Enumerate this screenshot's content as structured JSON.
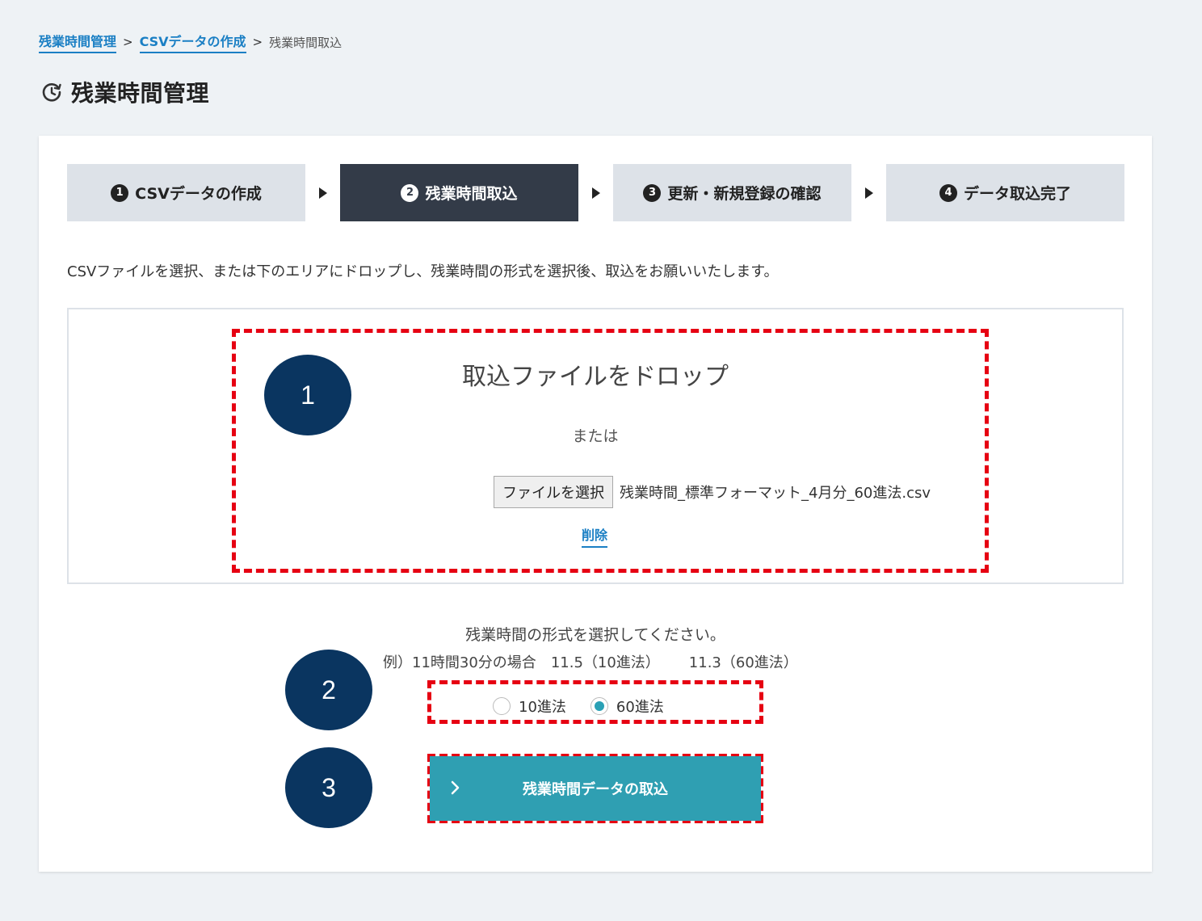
{
  "breadcrumb": {
    "items": [
      "残業時間管理",
      "CSVデータの作成"
    ],
    "separator": ">",
    "current": "残業時間取込"
  },
  "page": {
    "title": "残業時間管理"
  },
  "steps": [
    {
      "num": "1",
      "label": "CSVデータの作成"
    },
    {
      "num": "2",
      "label": "残業時間取込"
    },
    {
      "num": "3",
      "label": "更新・新規登録の確認"
    },
    {
      "num": "4",
      "label": "データ取込完了"
    }
  ],
  "instruction": "CSVファイルを選択、または下のエリアにドロップし、残業時間の形式を選択後、取込をお願いいたします。",
  "drop": {
    "title": "取込ファイルをドロップ",
    "or": "または",
    "file_button": "ファイルを選択",
    "file_name": "残業時間_標準フォーマット_4月分_60進法.csv",
    "delete": "削除"
  },
  "badges": [
    "1",
    "2",
    "3"
  ],
  "format": {
    "label": "残業時間の形式を選択してください。",
    "example_prefix": "例）11時間30分の場合",
    "example_decimal": "11.5（10進法）",
    "example_sexagesimal": "11.3（60進法）",
    "options": [
      {
        "label": "10進法",
        "selected": false
      },
      {
        "label": "60進法",
        "selected": true
      }
    ]
  },
  "submit": {
    "label": "残業時間データの取込"
  },
  "colors": {
    "accent": "#2f9fb2",
    "link": "#1a7fc4",
    "active_step": "#333b48",
    "badge": "#0a3560",
    "highlight": "#e60012"
  }
}
